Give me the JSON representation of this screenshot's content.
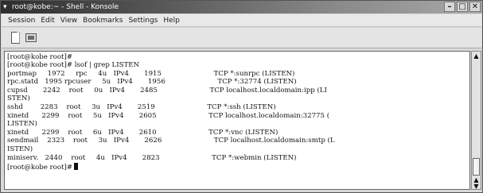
{
  "window": {
    "title": "root@kobe:~ - Shell - Konsole",
    "buttons": {
      "minimize": "–",
      "maximize": "□",
      "close": "✕"
    }
  },
  "menubar": [
    "Session",
    "Edit",
    "View",
    "Bookmarks",
    "Settings",
    "Help"
  ],
  "toolbar": {
    "new_icon": "new-session-icon",
    "terminal_icon": "terminal-icon"
  },
  "terminal": {
    "lines": [
      "[root@kobe root]#",
      "[root@kobe root]# lsof | grep LISTEN",
      "portmap     1972     rpc     4u   IPv4       1915                        TCP *:sunrpc (LISTEN)",
      "rpc.statd   1995 rpcuser     5u   IPv4       1956                        TCP *:32774 (LISTEN)",
      "cupsd       2242    root     0u   IPv4       2485                        TCP localhost.localdomain:ipp (LI",
      "STEN)",
      "sshd        2283    root     3u   IPv4       2519                        TCP *:ssh (LISTEN)",
      "xinetd      2299    root     5u   IPv4       2605                        TCP localhost.localdomain:32775 (",
      "LISTEN)",
      "xinetd      2299    root     6u   IPv4       2610                        TCP *:vnc (LISTEN)",
      "sendmail    2323    root     3u   IPv4       2626                        TCP localhost.localdomain:smtp (L",
      "ISTEN)",
      "miniserv.   2440    root     4u   IPv4       2823                        TCP *:webmin (LISTEN)"
    ],
    "prompt": "[root@kobe root]#"
  },
  "scrollbar": {
    "up": "▲",
    "down": "▲\n▼"
  }
}
